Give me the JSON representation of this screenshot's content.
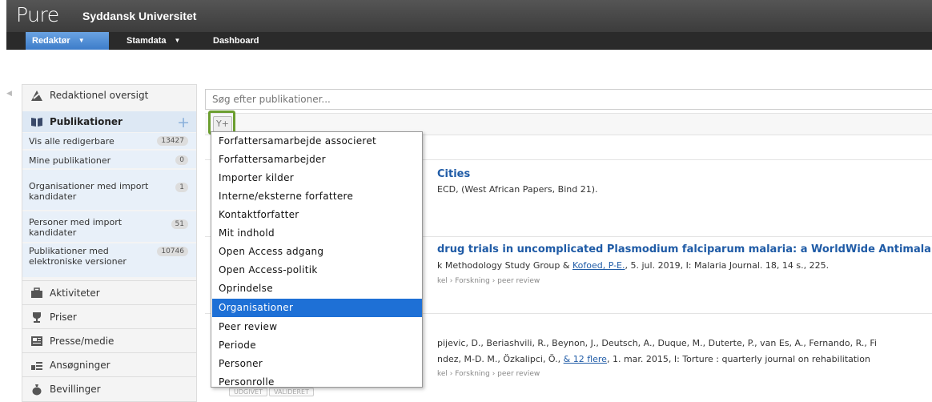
{
  "brand": {
    "logo": "Pure",
    "institution": "Syddansk Universitet"
  },
  "nav": {
    "redaktor": "Redaktør",
    "stamdata": "Stamdata",
    "dashboard": "Dashboard"
  },
  "sidebar": {
    "overview": "Redaktionel oversigt",
    "publications": "Publikationer",
    "sub": [
      {
        "label": "Vis alle redigerbare",
        "count": "13427"
      },
      {
        "label": "Mine publikationer",
        "count": "0"
      },
      {
        "label": "Organisationer med import kandidater",
        "count": "1"
      },
      {
        "label": "Personer med import kandidater",
        "count": "51"
      },
      {
        "label": "Publikationer med elektroniske versioner",
        "count": "10746"
      }
    ],
    "items": [
      "Aktiviteter",
      "Priser",
      "Presse/medie",
      "Ansøgninger",
      "Bevillinger"
    ]
  },
  "search": {
    "placeholder": "Søg efter publikationer..."
  },
  "filter": {
    "icon": "filter-add-icon",
    "label": "Y+"
  },
  "results": [
    {
      "title": "Cities",
      "meta": "ECD, (West African Papers, Bind 21)."
    },
    {
      "title": "drug trials in uncomplicated Plasmodium falciparum malaria: a WorldWide Antimalarial Resi",
      "meta_pre": "k Methodology Study Group & ",
      "meta_link": "Kofoed, P-E.",
      "meta_post": ", 5. jul. 2019, I: Malaria Journal. 18, 14 s., 225.",
      "cat": "kel › Forskning › peer review"
    },
    {
      "meta1": "pijevic, D., Beriashvili, R., Beynon, J., Deutsch, A., Duque, M., Duterte, P., van Es, A., Fernando, R., Fi",
      "meta2_pre": "ndez, M-D. M., Özkalipci, Ö., ",
      "meta2_link": "& 12 flere",
      "meta2_post": ", 1. mar. 2015, I: Torture : quarterly journal on rehabilitation",
      "cat": "kel › Forskning › peer review",
      "tags": [
        "UDGIVET",
        "VALIDERET"
      ]
    }
  ],
  "dropdown": {
    "items": [
      "Forfattersamarbejde associeret",
      "Forfattersamarbejder",
      "Importer kilder",
      "Interne/eksterne forfattere",
      "Kontaktforfatter",
      "Mit indhold",
      "Open Access adgang",
      "Open Access-politik",
      "Oprindelse",
      "Organisationer",
      "Peer review",
      "Periode",
      "Personer",
      "Personrolle"
    ],
    "selected": "Organisationer"
  },
  "colors": {
    "accent": "#1e70d6",
    "nav_active": "#3d7cc9",
    "filter_highlight": "#6b9e2f",
    "link": "#1f5ba6"
  }
}
